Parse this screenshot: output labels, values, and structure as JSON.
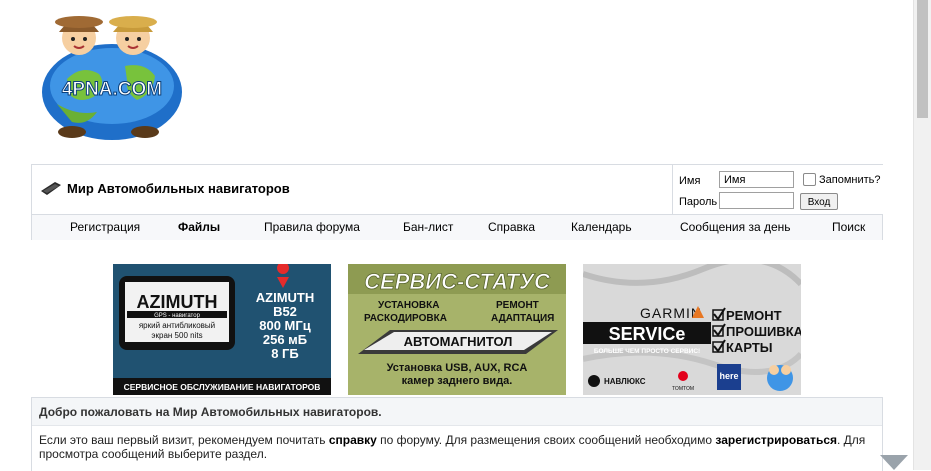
{
  "logo": {
    "text": "4PNA.COM"
  },
  "forum": {
    "title": "Мир Автомобильных навигаторов"
  },
  "login": {
    "username_label": "Имя",
    "username_value": "Имя",
    "password_label": "Пароль",
    "password_value": "",
    "remember_label": "Запомнить?",
    "submit_label": "Вход"
  },
  "nav": {
    "items": [
      {
        "label": "Регистрация"
      },
      {
        "label": "Файлы"
      },
      {
        "label": "Правила форума"
      },
      {
        "label": "Бан-лист"
      },
      {
        "label": "Справка"
      },
      {
        "label": "Календарь"
      },
      {
        "label": "Сообщения за день"
      },
      {
        "label": "Поиск"
      }
    ]
  },
  "banners": {
    "azimuth": {
      "brand": "AZIMUTH",
      "tagline": "GPS - навигатор",
      "screen1": "яркий антибликовый",
      "screen2": "экран 500 nits",
      "model": "AZIMUTH",
      "model2": "B52",
      "spec1": "800 МГц",
      "spec2": "256 мБ",
      "spec3": "8 ГБ",
      "footer": "СЕРВИСНОЕ ОБСЛУЖИВАНИЕ НАВИГАТОРОВ"
    },
    "service_status": {
      "title": "СЕРВИС-СТАТУС",
      "item1": "УСТАНОВКА",
      "item2": "РЕМОНТ",
      "item3": "РАСКОДИРОВКА",
      "item4": "АДАПТАЦИЯ",
      "band": "АВТОМАГНИТОЛ",
      "line1": "Установка USB, AUX, RCA",
      "line2": "камер заднего вида."
    },
    "garmin": {
      "brand": "GARMIN",
      "service": "SERVICe",
      "sub": "БОЛЬШЕ ЧЕМ ПРОСТО СЕРВИС!",
      "check1": "РЕМОНТ",
      "check2": "ПРОШИВКА",
      "check3": "КАРТЫ",
      "logo1": "НАВЛЮКС",
      "logo2": "TOMTOM",
      "logo3": "here"
    }
  },
  "welcome": {
    "title": "Добро пожаловать на Мир Автомобильных навигаторов.",
    "p1": "Если это ваш первый визит, рекомендуем почитать ",
    "help_link": "справку",
    "p2": " по форуму. Для размещения своих сообщений необходимо ",
    "register_link": "зарегистрироваться",
    "p3": ". Для просмотра сообщений выберите раздел."
  }
}
